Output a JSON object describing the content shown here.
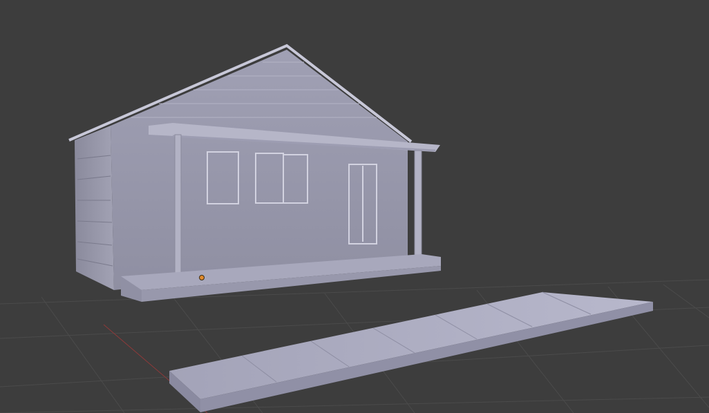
{
  "viewport": {
    "view": "perspective",
    "shading": "solid",
    "background_color": "#3d3d3d",
    "grid_color": "#4a4a4a",
    "x_axis_color": "#8e3a3a",
    "model_color": "#9e9eb0"
  },
  "scene": {
    "objects": [
      {
        "name": "house",
        "type": "mesh"
      },
      {
        "name": "porch",
        "type": "mesh"
      },
      {
        "name": "sidewalk",
        "type": "mesh"
      }
    ],
    "origin_marker": {
      "name": "object-origin",
      "color": "#e08a2e"
    }
  }
}
